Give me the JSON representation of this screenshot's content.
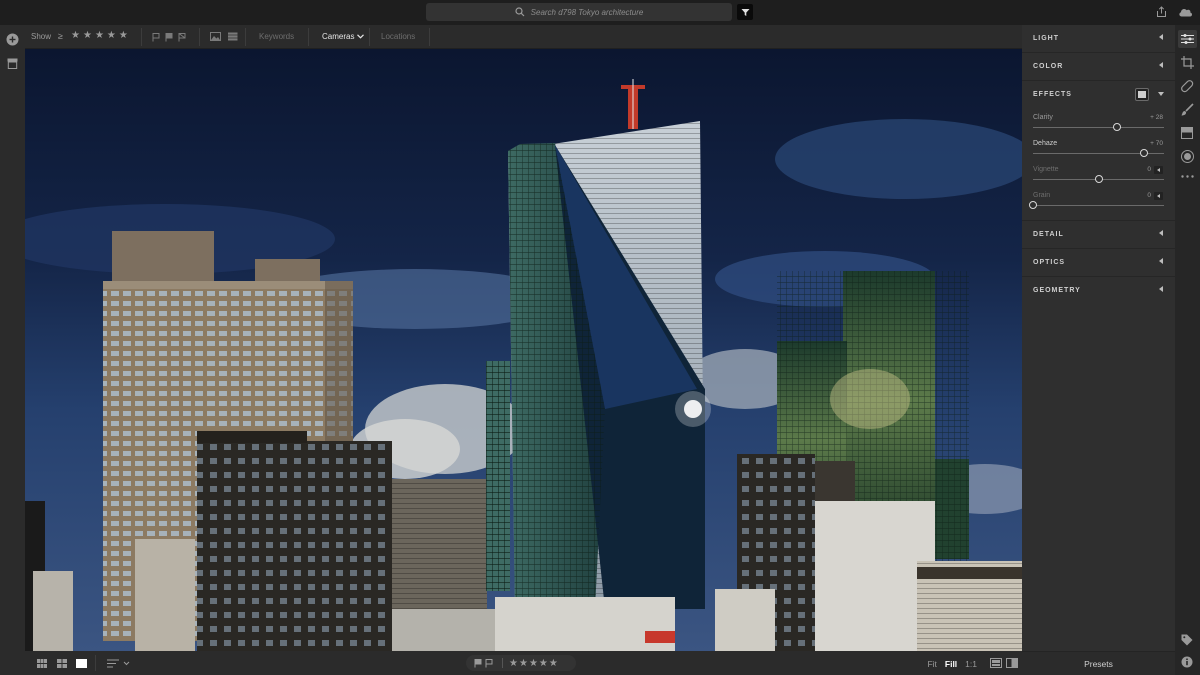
{
  "search": {
    "placeholder": "Search d798 Tokyo architecture"
  },
  "filterbar": {
    "show_label": "Show",
    "rating_op": "≥",
    "keywords_label": "Keywords",
    "cameras_label": "Cameras",
    "locations_label": "Locations"
  },
  "panel": {
    "light": "LIGHT",
    "color": "COLOR",
    "effects": "EFFECTS",
    "detail": "DETAIL",
    "optics": "OPTICS",
    "geometry": "GEOMETRY",
    "sliders": [
      {
        "label": "Clarity",
        "value": "+ 28",
        "level": 0.64
      },
      {
        "label": "Dehaze",
        "value": "+ 70",
        "level": 0.85
      },
      {
        "label": "Vignette",
        "value": "0",
        "level": 0.5
      },
      {
        "label": "Grain",
        "value": "0",
        "level": 0.0
      }
    ]
  },
  "bottombar": {
    "fit": "Fit",
    "fill": "Fill",
    "one_to_one": "1:1"
  },
  "presets_label": "Presets"
}
